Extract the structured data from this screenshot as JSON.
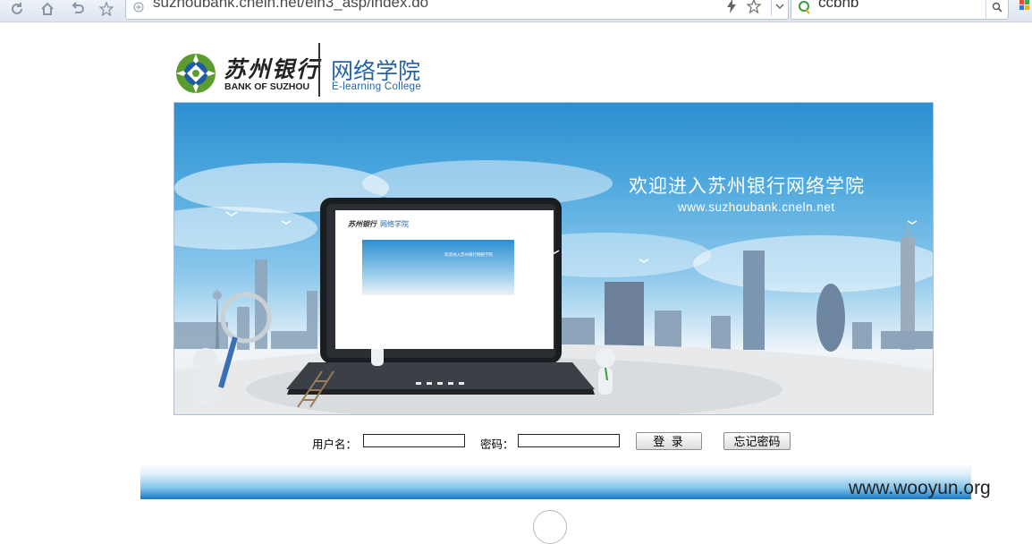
{
  "browser": {
    "url": "suzhoubank.cneln.net/eln3_asp/index.do",
    "search_value": "ccbnb",
    "icons": [
      "reload-icon",
      "home-icon",
      "undo-icon",
      "favorite-icon",
      "site-info-icon",
      "bolt-icon",
      "star-icon",
      "dropdown-icon",
      "search-engine-icon",
      "magnifier-icon",
      "apps-icon"
    ]
  },
  "logo": {
    "bank_name_cn": "苏州银行",
    "bank_name_en": "BANK OF SUZHOU",
    "college_cn": "网络学院",
    "college_en": "E-learning  College"
  },
  "banner": {
    "welcome": "欢迎进入苏州银行网络学院",
    "url": "www.suzhoubank.cneln.net",
    "mini_logo_cn": "苏州银行",
    "mini_college": "网络学院",
    "mini_welcome": "欢迎进入苏州银行网络学院"
  },
  "login": {
    "username_label": "用户名：",
    "username_value": "",
    "password_label": "密码：",
    "password_value": "",
    "login_button": "登 录",
    "forgot_button": "忘记密码"
  },
  "watermark": "www.wooyun.org",
  "colors": {
    "brand_blue": "#2363a8",
    "banner_sky": "#2d8ed0",
    "footer_blue": "#1778c4",
    "logo_green": "#5a9c2e"
  }
}
